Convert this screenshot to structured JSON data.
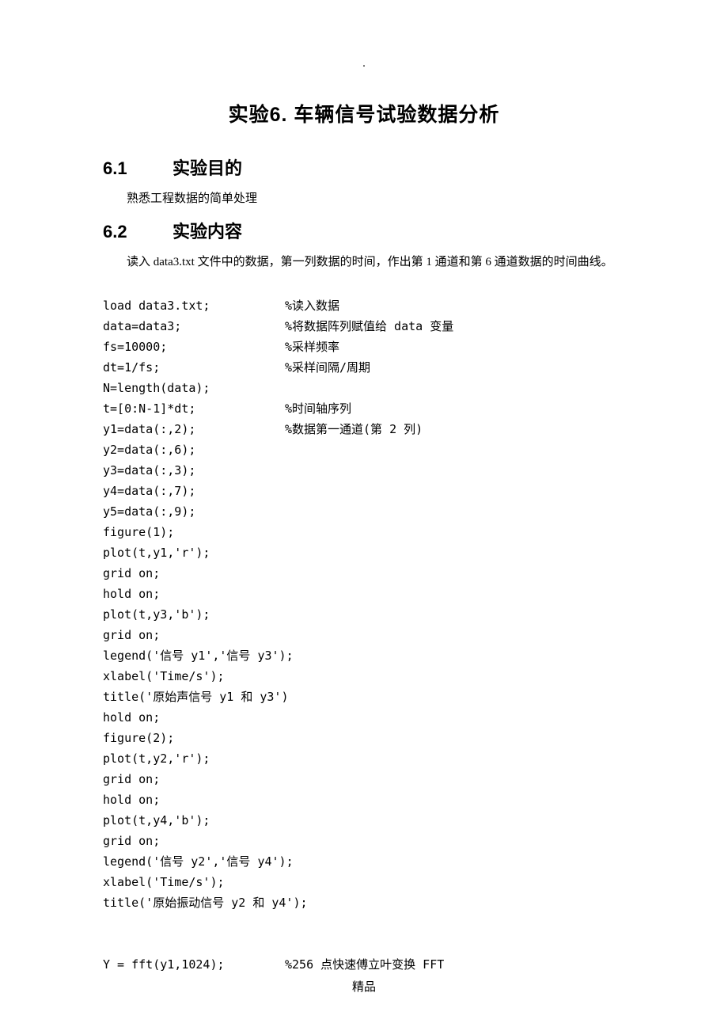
{
  "header_dot": ".",
  "title_main": "实验6.   车辆信号试验数据分析",
  "section1": {
    "number": "6.1",
    "title": "实验目的",
    "text": "熟悉工程数据的简单处理"
  },
  "section2": {
    "number": "6.2",
    "title": "实验内容",
    "text": "读入 data3.txt 文件中的数据，第一列数据的时间，作出第 1 通道和第 6 通道数据的时间曲线。"
  },
  "code": {
    "lines": [
      {
        "code": "load data3.txt;",
        "comment": "%读入数据"
      },
      {
        "code": "data=data3;",
        "comment": "%将数据阵列赋值给 data 变量"
      },
      {
        "code": "fs=10000;",
        "comment": "%采样频率"
      },
      {
        "code": "dt=1/fs;",
        "comment": "%采样间隔/周期"
      },
      {
        "code": "N=length(data);",
        "comment": ""
      },
      {
        "code": "t=[0:N-1]*dt;",
        "comment": "%时间轴序列"
      },
      {
        "code": "y1=data(:,2);",
        "comment": "%数据第一通道(第 2 列)"
      },
      {
        "code": "y2=data(:,6);",
        "comment": ""
      },
      {
        "code": "y3=data(:,3);",
        "comment": ""
      },
      {
        "code": "y4=data(:,7);",
        "comment": ""
      },
      {
        "code": "y5=data(:,9);",
        "comment": ""
      },
      {
        "code": "figure(1);",
        "comment": ""
      },
      {
        "code": "plot(t,y1,'r');",
        "comment": ""
      },
      {
        "code": "grid on;",
        "comment": ""
      },
      {
        "code": "hold on;",
        "comment": ""
      },
      {
        "code": "plot(t,y3,'b');",
        "comment": ""
      },
      {
        "code": "grid on;",
        "comment": ""
      },
      {
        "code": "legend('信号 y1','信号 y3');",
        "comment": ""
      },
      {
        "code": "xlabel('Time/s');",
        "comment": ""
      },
      {
        "code": "title('原始声信号 y1 和 y3')",
        "comment": ""
      },
      {
        "code": "hold on;",
        "comment": ""
      },
      {
        "code": "figure(2);",
        "comment": ""
      },
      {
        "code": "plot(t,y2,'r');",
        "comment": ""
      },
      {
        "code": "grid on;",
        "comment": ""
      },
      {
        "code": "hold on;",
        "comment": ""
      },
      {
        "code": "plot(t,y4,'b');",
        "comment": ""
      },
      {
        "code": "grid on;",
        "comment": ""
      },
      {
        "code": "legend('信号 y2','信号 y4');",
        "comment": ""
      },
      {
        "code": "xlabel('Time/s');",
        "comment": ""
      },
      {
        "code": "title('原始振动信号 y2 和 y4');",
        "comment": ""
      }
    ],
    "blank_gap": "",
    "last_line": {
      "code": "Y = fft(y1,1024);",
      "comment": "%256 点快速傅立叶变换 FFT"
    }
  },
  "footer": "精品"
}
